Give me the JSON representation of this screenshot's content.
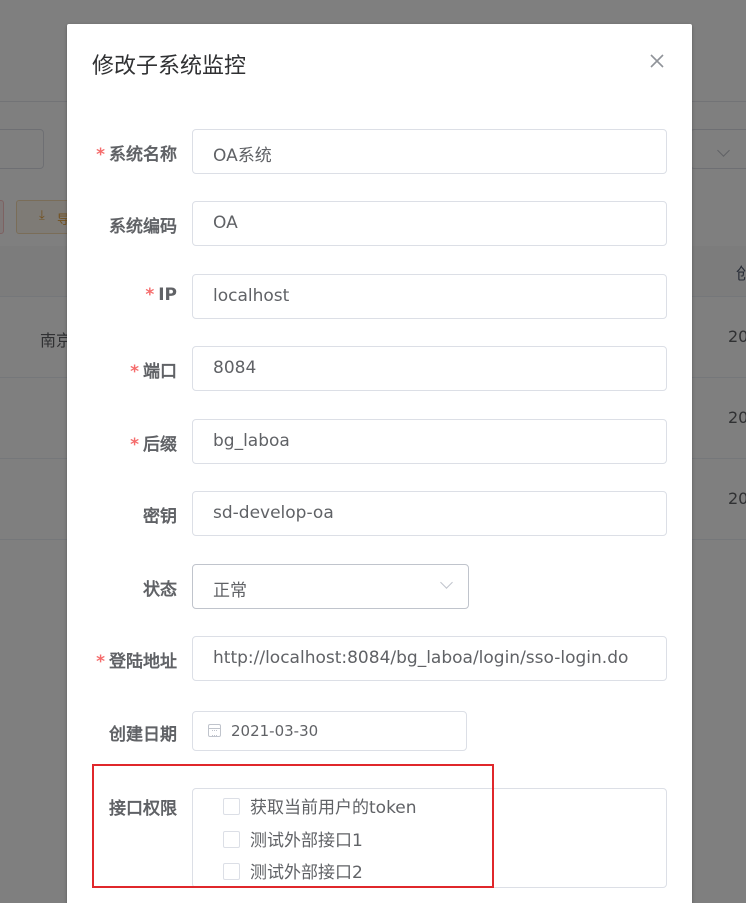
{
  "dialog": {
    "title": "修改子系统监控",
    "fields": {
      "name": {
        "label": "系统名称",
        "value": "OA系统"
      },
      "code": {
        "label": "系统编码",
        "value": "OA"
      },
      "ip": {
        "label": "IP",
        "value": "localhost"
      },
      "port": {
        "label": "端口",
        "value": "8084"
      },
      "suffix": {
        "label": "后缀",
        "value": "bg_laboa"
      },
      "secret": {
        "label": "密钥",
        "value": "sd-develop-oa"
      },
      "status": {
        "label": "状态",
        "value": "正常"
      },
      "login_url": {
        "label": "登陆地址",
        "value": "http://localhost:8084/bg_laboa/login/sso-login.do"
      },
      "created_date": {
        "label": "创建日期",
        "value": "2021-03-30"
      },
      "permissions": {
        "label": "接口权限",
        "options": [
          {
            "label": "获取当前用户的token",
            "checked": false
          },
          {
            "label": "测试外部接口1",
            "checked": false
          },
          {
            "label": "测试外部接口2",
            "checked": false
          }
        ]
      }
    },
    "required_mark": "*"
  },
  "background": {
    "export_button": "导",
    "table_header_partial": "创",
    "rows": [
      {
        "col1": "南京",
        "col2": "20"
      },
      {
        "col1": "",
        "col2": "20"
      },
      {
        "col1": "",
        "col2": "20"
      }
    ]
  },
  "colors": {
    "required": "#f56c6c",
    "highlight_border": "#e0272b"
  }
}
